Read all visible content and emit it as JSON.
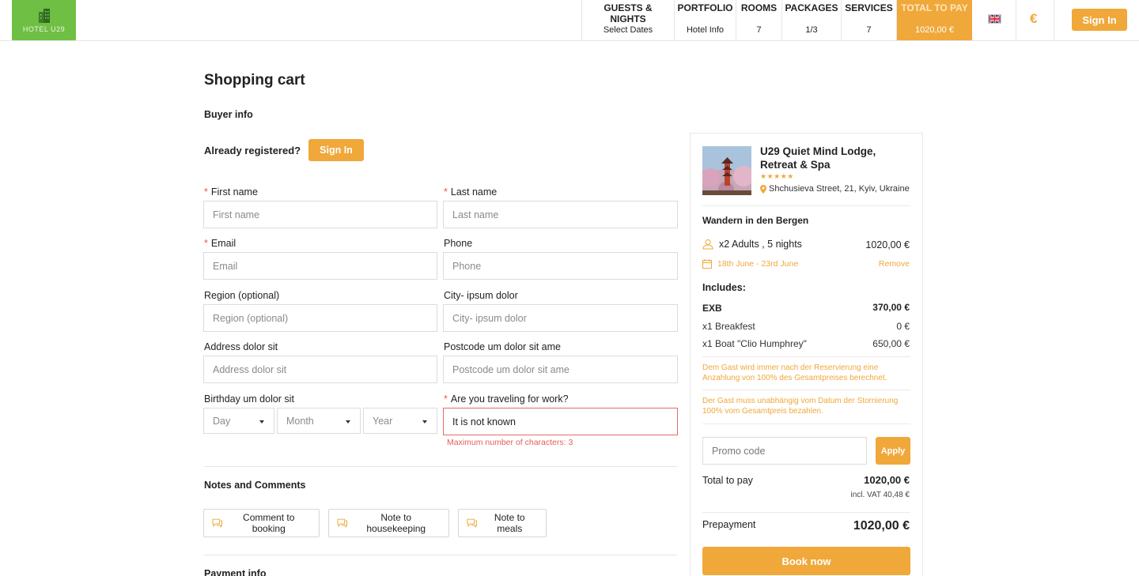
{
  "header": {
    "logo_text": "HOTEL U29",
    "nav": [
      {
        "title": "GUESTS & NIGHTS",
        "value": "Select Dates"
      },
      {
        "title": "PORTFOLIO",
        "value": "Hotel Info"
      },
      {
        "title": "ROOMS",
        "value": "7"
      },
      {
        "title": "PACKAGES",
        "value": "1/3"
      },
      {
        "title": "SERVICES",
        "value": "7"
      },
      {
        "title": "TOTAL TO PAY",
        "value": "1020,00 €"
      }
    ],
    "language_icon": "uk-flag-icon",
    "currency": "€",
    "signin_label": "Sign In",
    "accent_color": "#f0a83a",
    "logo_color": "#6fbf44"
  },
  "page": {
    "title": "Shopping cart",
    "buyer_info": "Buyer info",
    "already_registered": "Already registered?",
    "signin_label": "Sign In"
  },
  "form": {
    "first_name": {
      "label": "First name",
      "placeholder": "First name",
      "required": true
    },
    "last_name": {
      "label": "Last name",
      "placeholder": "Last name",
      "required": true
    },
    "email": {
      "label": "Email",
      "placeholder": "Email",
      "required": true
    },
    "phone": {
      "label": "Phone",
      "placeholder": "Phone"
    },
    "region": {
      "label": "Region (optional)",
      "placeholder": "Region (optional)"
    },
    "city": {
      "label": "City- ipsum dolor",
      "placeholder": "City- ipsum dolor"
    },
    "address": {
      "label": "Address dolor sit",
      "placeholder": "Address dolor sit"
    },
    "postcode": {
      "label": "Postcode um dolor sit ame",
      "placeholder": "Postcode um dolor sit ame"
    },
    "birthday": {
      "label": "Birthday um dolor sit",
      "day": "Day",
      "month": "Month",
      "year": "Year"
    },
    "work": {
      "label": "Are you traveling for work?",
      "value": "It is not known",
      "error": "Maximum number of characters: 3",
      "required": true
    }
  },
  "notes": {
    "title": "Notes and Comments",
    "buttons": [
      "Comment to booking",
      "Note to housekeeping",
      "Note to meals"
    ]
  },
  "payment": {
    "title": "Payment info"
  },
  "summary": {
    "hotel_name": "U29 Quiet Mind Lodge, Retreat & Spa",
    "stars": "★★★★★",
    "address": "Shchusieva Street, 21, Kyiv, Ukraine",
    "package_name": "Wandern in den Bergen",
    "guests": "x2 Adults , 5 nights",
    "guests_price": "1020,00 €",
    "dates": "18th June - 23rd June",
    "remove_label": "Remove",
    "includes_label": "Includes:",
    "items": [
      {
        "label": "EXB",
        "price": "370,00 €",
        "bold": true
      },
      {
        "label": "x1 Breakfest",
        "price": "0 €"
      },
      {
        "label": "x1 Boat \"Clio Humphrey\"",
        "price": "650,00 €"
      }
    ],
    "policy_1": "Dem Gast wird immer nach der Reservierung eine Anzahlung von 100% des Gesamtpreises berechnet.",
    "policy_2": "Der Gast muss unabhängig vom Datum der Stornierung 100% vom Gesamtpreis bezahlen.",
    "promo_placeholder": "Promo code",
    "apply_label": "Apply",
    "total_label": "Total to pay",
    "total_value": "1020,00 €",
    "vat": "incl. VAT 40,48 €",
    "prepayment_label": "Prepayment",
    "prepayment_value": "1020,00 €",
    "book_label": "Book now"
  }
}
